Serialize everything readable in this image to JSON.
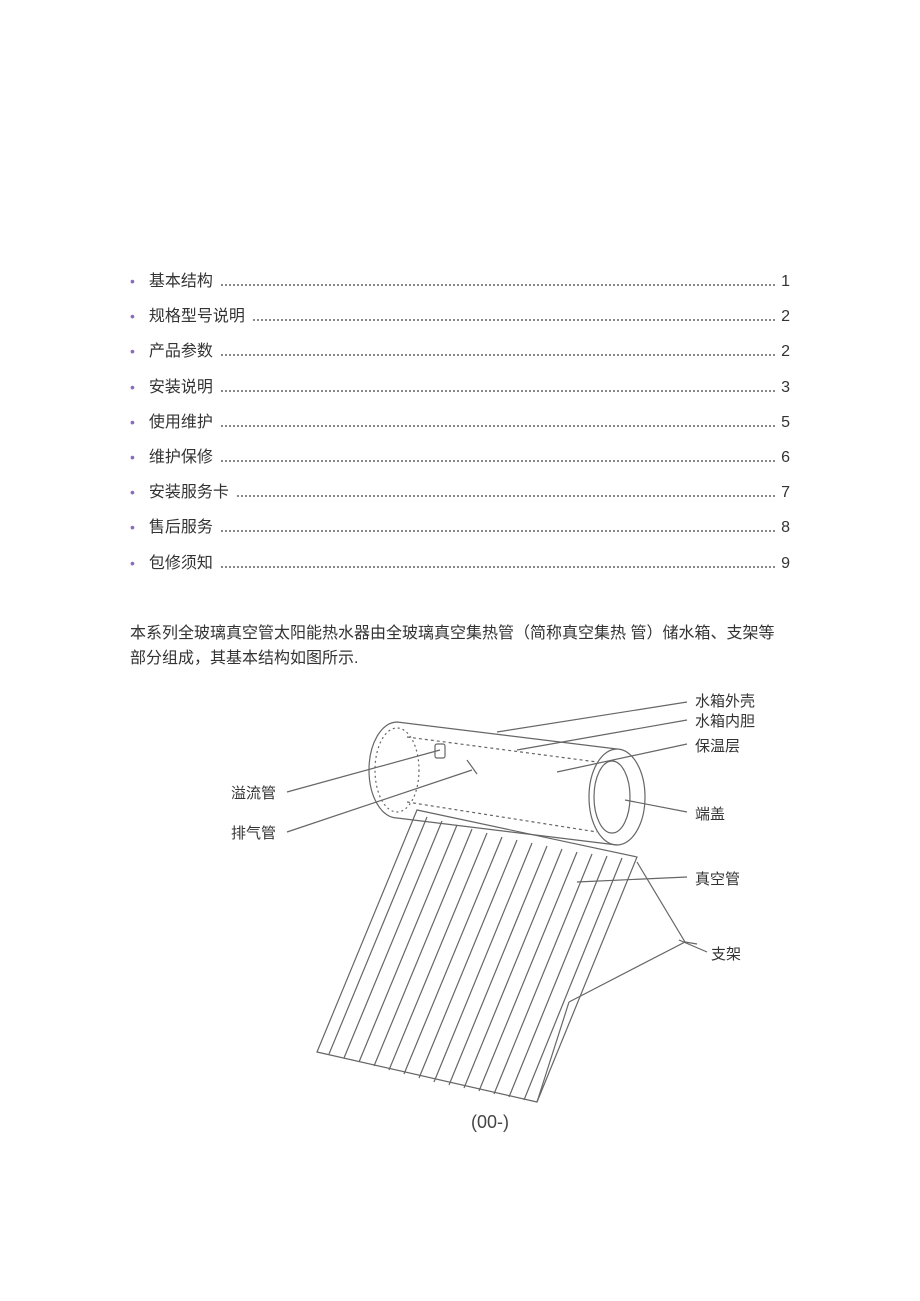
{
  "toc": {
    "items": [
      {
        "label": "基本结构",
        "page": "1"
      },
      {
        "label": "规格型号说明",
        "page": "2"
      },
      {
        "label": "产品参数",
        "page": "2"
      },
      {
        "label": "安装说明",
        "page": "3"
      },
      {
        "label": "使用维护",
        "page": "5"
      },
      {
        "label": "维护保修",
        "page": "6"
      },
      {
        "label": "安装服务卡",
        "page": "7"
      },
      {
        "label": "售后服务",
        "page": "8"
      },
      {
        "label": "包修须知",
        "page": "9"
      }
    ]
  },
  "intro": "本系列全玻璃真空管太阳能热水器由全玻璃真空集热管（简称真空集热 管）储水箱、支架等部分组成，其基本结构如图所示.",
  "diagram": {
    "labels": {
      "overflow_pipe": "溢流管",
      "exhaust_pipe": "排气管",
      "tank_shell": "水箱外壳",
      "tank_liner": "水箱内胆",
      "insulation": "保温层",
      "end_cap": "端盖",
      "vacuum_tube": "真空管",
      "bracket": "支架"
    },
    "caption": "(00-)"
  }
}
